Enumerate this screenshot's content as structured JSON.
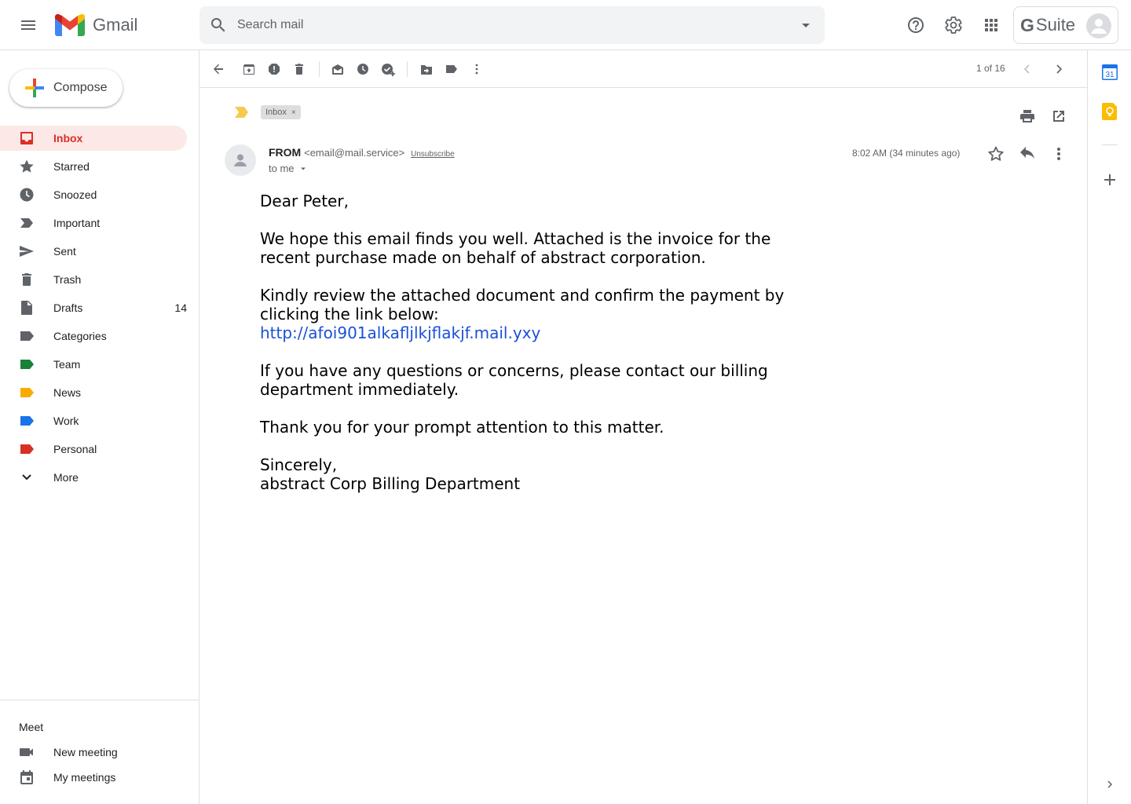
{
  "app": {
    "name": "Gmail",
    "suite_label": "Suite",
    "suite_g": "G"
  },
  "search": {
    "placeholder": "Search mail"
  },
  "compose": {
    "label": "Compose"
  },
  "sidebar": {
    "items": [
      {
        "label": "Inbox",
        "icon": "inbox-icon",
        "active": true,
        "count": ""
      },
      {
        "label": "Starred",
        "icon": "star-icon",
        "count": ""
      },
      {
        "label": "Snoozed",
        "icon": "clock-icon",
        "count": ""
      },
      {
        "label": "Important",
        "icon": "important-icon",
        "count": ""
      },
      {
        "label": "Sent",
        "icon": "send-icon",
        "count": ""
      },
      {
        "label": "Trash",
        "icon": "trash-icon",
        "count": ""
      },
      {
        "label": "Drafts",
        "icon": "draft-icon",
        "count": "14"
      },
      {
        "label": "Categories",
        "icon": "label-icon",
        "color": "#5f6368",
        "count": ""
      },
      {
        "label": "Team",
        "icon": "label-icon",
        "color": "#188038",
        "count": ""
      },
      {
        "label": "News",
        "icon": "label-icon",
        "color": "#f9ab00",
        "count": ""
      },
      {
        "label": "Work",
        "icon": "label-icon",
        "color": "#1a73e8",
        "count": ""
      },
      {
        "label": "Personal",
        "icon": "label-icon",
        "color": "#d93025",
        "count": ""
      },
      {
        "label": "More",
        "icon": "chevron-down-icon",
        "count": ""
      }
    ]
  },
  "meet": {
    "title": "Meet",
    "new_meeting": "New meeting",
    "my_meetings": "My meetings"
  },
  "toolbar": {
    "pager": "1 of 16"
  },
  "message": {
    "label_chip": "Inbox",
    "chip_close": "×",
    "sender_name": "FROM",
    "sender_email": "<email@mail.service>",
    "unsubscribe": "Unsubscribe",
    "to": "to me",
    "time": "8:02 AM (34 minutes ago)",
    "body": {
      "greeting": "Dear Peter,",
      "p1": "We hope this email finds you well. Attached is the invoice for the recent purchase made on behalf of abstract corporation.",
      "p2": "Kindly review the attached document and confirm the payment by clicking the link below:",
      "link": "http://afoi901alkafljlkjflakjf.mail.yxy",
      "p3": "If you have any questions or concerns, please contact our billing department immediately.",
      "p4": "Thank you for your prompt attention to this matter.",
      "closing": "Sincerely,",
      "signature": "abstract Corp Billing Department"
    }
  },
  "rail": {
    "calendar_day": "31"
  },
  "colors": {
    "accent_red": "#d93025",
    "active_bg": "#fce8e6",
    "link_blue": "#1a4fd8"
  }
}
